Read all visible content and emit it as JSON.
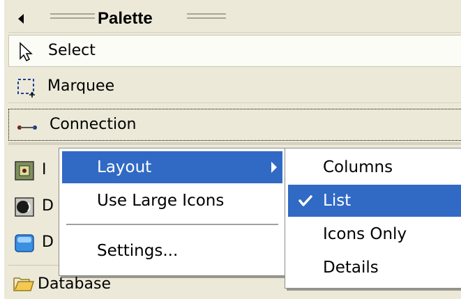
{
  "palette": {
    "title": "Palette",
    "tools": {
      "select": "Select",
      "marquee": "Marquee",
      "connection": "Connection"
    },
    "entries": [
      {
        "label": "I",
        "icon": "component-icon"
      },
      {
        "label": "D",
        "icon": "speaker-icon"
      },
      {
        "label": "D",
        "icon": "blue-box-icon"
      }
    ],
    "drawer": {
      "label": "Database",
      "icon": "folder-open-icon"
    }
  },
  "context_menu": {
    "items": {
      "layout": "Layout",
      "large_icons": "Use Large Icons",
      "settings": "Settings..."
    }
  },
  "layout_submenu": {
    "items": {
      "columns": "Columns",
      "list": "List",
      "icons_only": "Icons Only",
      "details": "Details"
    },
    "checked": "List"
  },
  "colors": {
    "highlight": "#316ac5",
    "palette_bg": "#ece9d8"
  }
}
